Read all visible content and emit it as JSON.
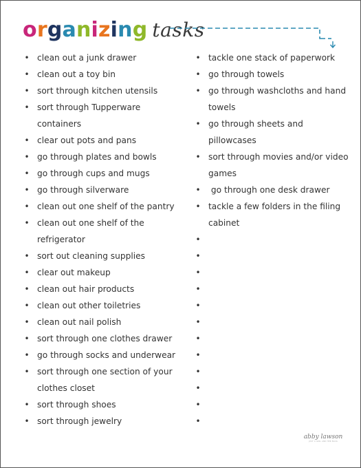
{
  "title": {
    "letters": [
      {
        "char": "o",
        "color": "#c8267a"
      },
      {
        "char": "r",
        "color": "#e8751f"
      },
      {
        "char": "g",
        "color": "#1f3560"
      },
      {
        "char": "a",
        "color": "#2a8ab0"
      },
      {
        "char": "n",
        "color": "#8fb82a"
      },
      {
        "char": "i",
        "color": "#c8267a"
      },
      {
        "char": "z",
        "color": "#e8751f"
      },
      {
        "char": "i",
        "color": "#1f3560"
      },
      {
        "char": "n",
        "color": "#2a8ab0"
      },
      {
        "char": "g",
        "color": "#8fb82a"
      }
    ],
    "main": "organizing",
    "script": "tasks"
  },
  "accent_color": "#2a8ab0",
  "left_column": [
    "clean out a junk drawer",
    "clean out a toy bin",
    "sort through kitchen utensils",
    "sort through Tupperware containers",
    "clear out pots and pans",
    "go through plates and bowls",
    "go through cups and mugs",
    "go through silverware",
    "clean out one shelf of the pantry",
    "clean out one shelf of the refrigerator",
    "sort out cleaning supplies",
    "clear out makeup",
    "clean out hair products",
    "clean out other toiletries",
    "clean out nail polish",
    "sort through one clothes drawer",
    "go through socks and underwear",
    "sort through one section of your clothes closet",
    "sort through shoes",
    "sort through jewelry"
  ],
  "right_column": [
    "tackle one stack of paperwork",
    "go through towels",
    "go through washcloths and hand towels",
    "go through sheets and pillowcases",
    "sort through movies and/or video games",
    " go through one desk drawer",
    "tackle a few folders in the filing cabinet",
    "",
    "",
    "",
    "",
    "",
    "",
    "",
    "",
    "",
    "",
    "",
    ""
  ],
  "bullet_char": "•",
  "logo": {
    "name": "abby lawson",
    "tagline": "JUST A GIRL AND HER BLOG"
  }
}
